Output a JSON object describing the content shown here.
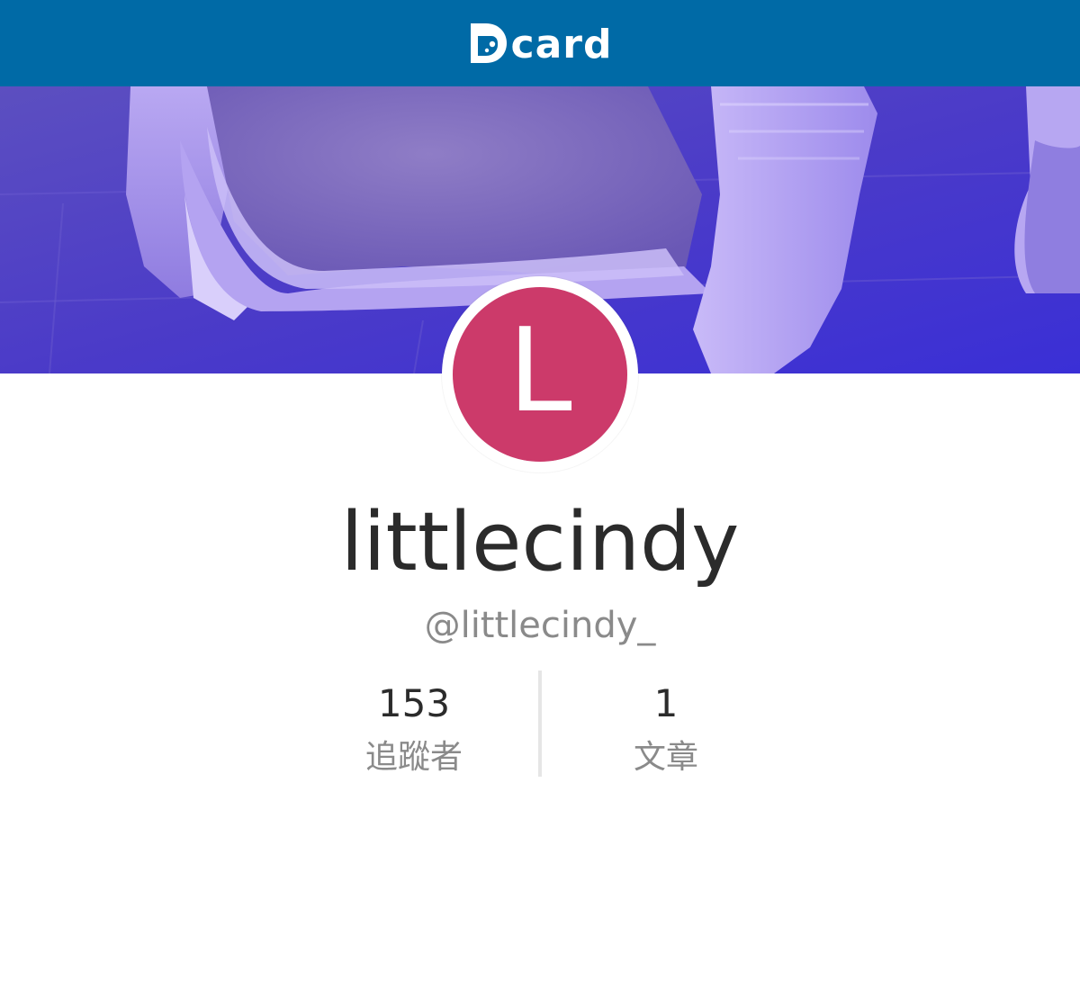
{
  "header": {
    "logo_text": "card",
    "background_color": "#006aa6"
  },
  "cover": {
    "dominant_color": "#4a3bc9"
  },
  "avatar": {
    "initial": "L",
    "color": "#cc3a6a"
  },
  "profile": {
    "display_name": "littlecindy",
    "handle": "@littlecindy_"
  },
  "stats": {
    "followers_value": "153",
    "followers_label": "追蹤者",
    "posts_value": "1",
    "posts_label": "文章"
  }
}
